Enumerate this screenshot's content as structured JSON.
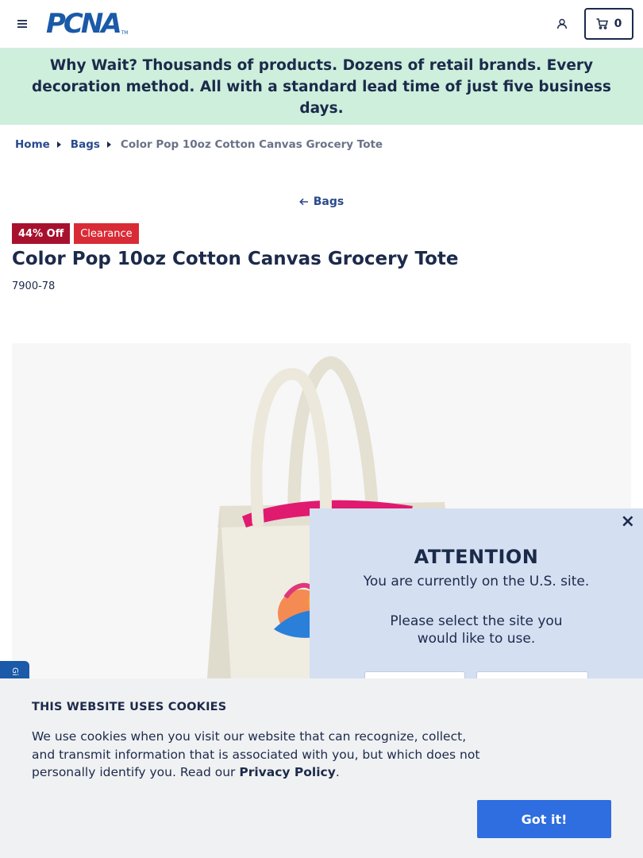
{
  "header": {
    "logo_text": "PCNA",
    "logo_tm": "TM",
    "cart_count": "0"
  },
  "promo": {
    "text": "Why Wait? Thousands of products. Dozens of retail brands. Every decoration method. All with a standard lead time of just five business days."
  },
  "breadcrumb": {
    "items": [
      "Home",
      "Bags"
    ],
    "current": "Color Pop 10oz Cotton Canvas Grocery Tote"
  },
  "back_link": {
    "label": "Bags"
  },
  "product": {
    "badges": {
      "discount": "44% Off",
      "clearance": "Clearance"
    },
    "title": "Color Pop 10oz Cotton Canvas Grocery Tote",
    "sku": "7900-78"
  },
  "side_tab": {
    "label": "Gi"
  },
  "modal": {
    "title": "ATTENTION",
    "line1": "You are currently on the U.S. site.",
    "line2": "Please select the site you would like to use.",
    "close": "×"
  },
  "cookie": {
    "title": "THIS WEBSITE USES COOKIES",
    "text_before": "We use cookies when you visit our website that can recognize, collect, and transmit information that is associated with you, but which does not personally identify you. Read our ",
    "link": "Privacy Policy",
    "text_after": ".",
    "button": "Got it!"
  },
  "colors": {
    "brand_blue": "#1a5aa8",
    "navy": "#1c2a4a",
    "promo_bg": "#cdefdc",
    "discount_badge": "#a8112e",
    "clearance_badge": "#d92b36",
    "modal_bg": "#d4dff2",
    "cookie_button": "#2f6ee0",
    "tote_accent": "#e01a6f"
  },
  "icons": [
    "hamburger-menu-icon",
    "user-icon",
    "cart-icon",
    "arrow-left-icon",
    "breadcrumb-arrow-icon",
    "close-icon"
  ]
}
